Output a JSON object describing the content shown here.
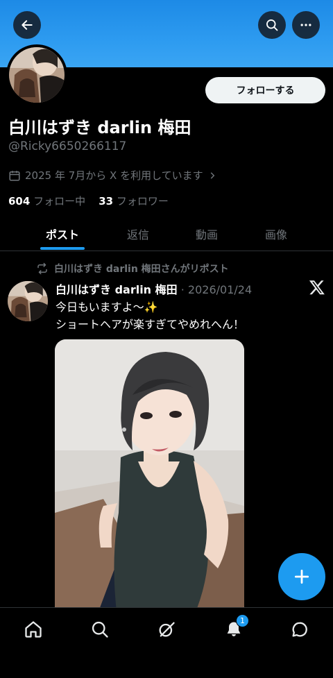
{
  "header": {
    "back_icon": "arrow-left-icon",
    "search_icon": "search-icon",
    "more_icon": "more-horizontal-icon",
    "banner_color": "#2d9bf0"
  },
  "profile": {
    "display_name": "白川はずき darlin 梅田",
    "handle": "@Ricky6650266117",
    "joined": "2025 年 7月から X を利用しています",
    "follow_label": "フォローする",
    "following_count": "604",
    "following_label": "フォロー中",
    "followers_count": "33",
    "followers_label": "フォロワー"
  },
  "tabs": [
    {
      "label": "ポスト",
      "active": true
    },
    {
      "label": "返信",
      "active": false
    },
    {
      "label": "動画",
      "active": false
    },
    {
      "label": "画像",
      "active": false
    }
  ],
  "post": {
    "repost_text": "白川はずき darlin 梅田さんがリポスト",
    "author": "白川はずき darlin 梅田",
    "date": "· 2026/01/24",
    "line1": "今日もいますよ〜✨",
    "line2": "ショートヘアが楽すぎてやめれへん！"
  },
  "bottom_nav": {
    "items": [
      "home-icon",
      "search-icon",
      "grok-icon",
      "notifications-icon",
      "messages-icon"
    ],
    "notification_badge": "1"
  },
  "accent_color": "#1d9bf0"
}
